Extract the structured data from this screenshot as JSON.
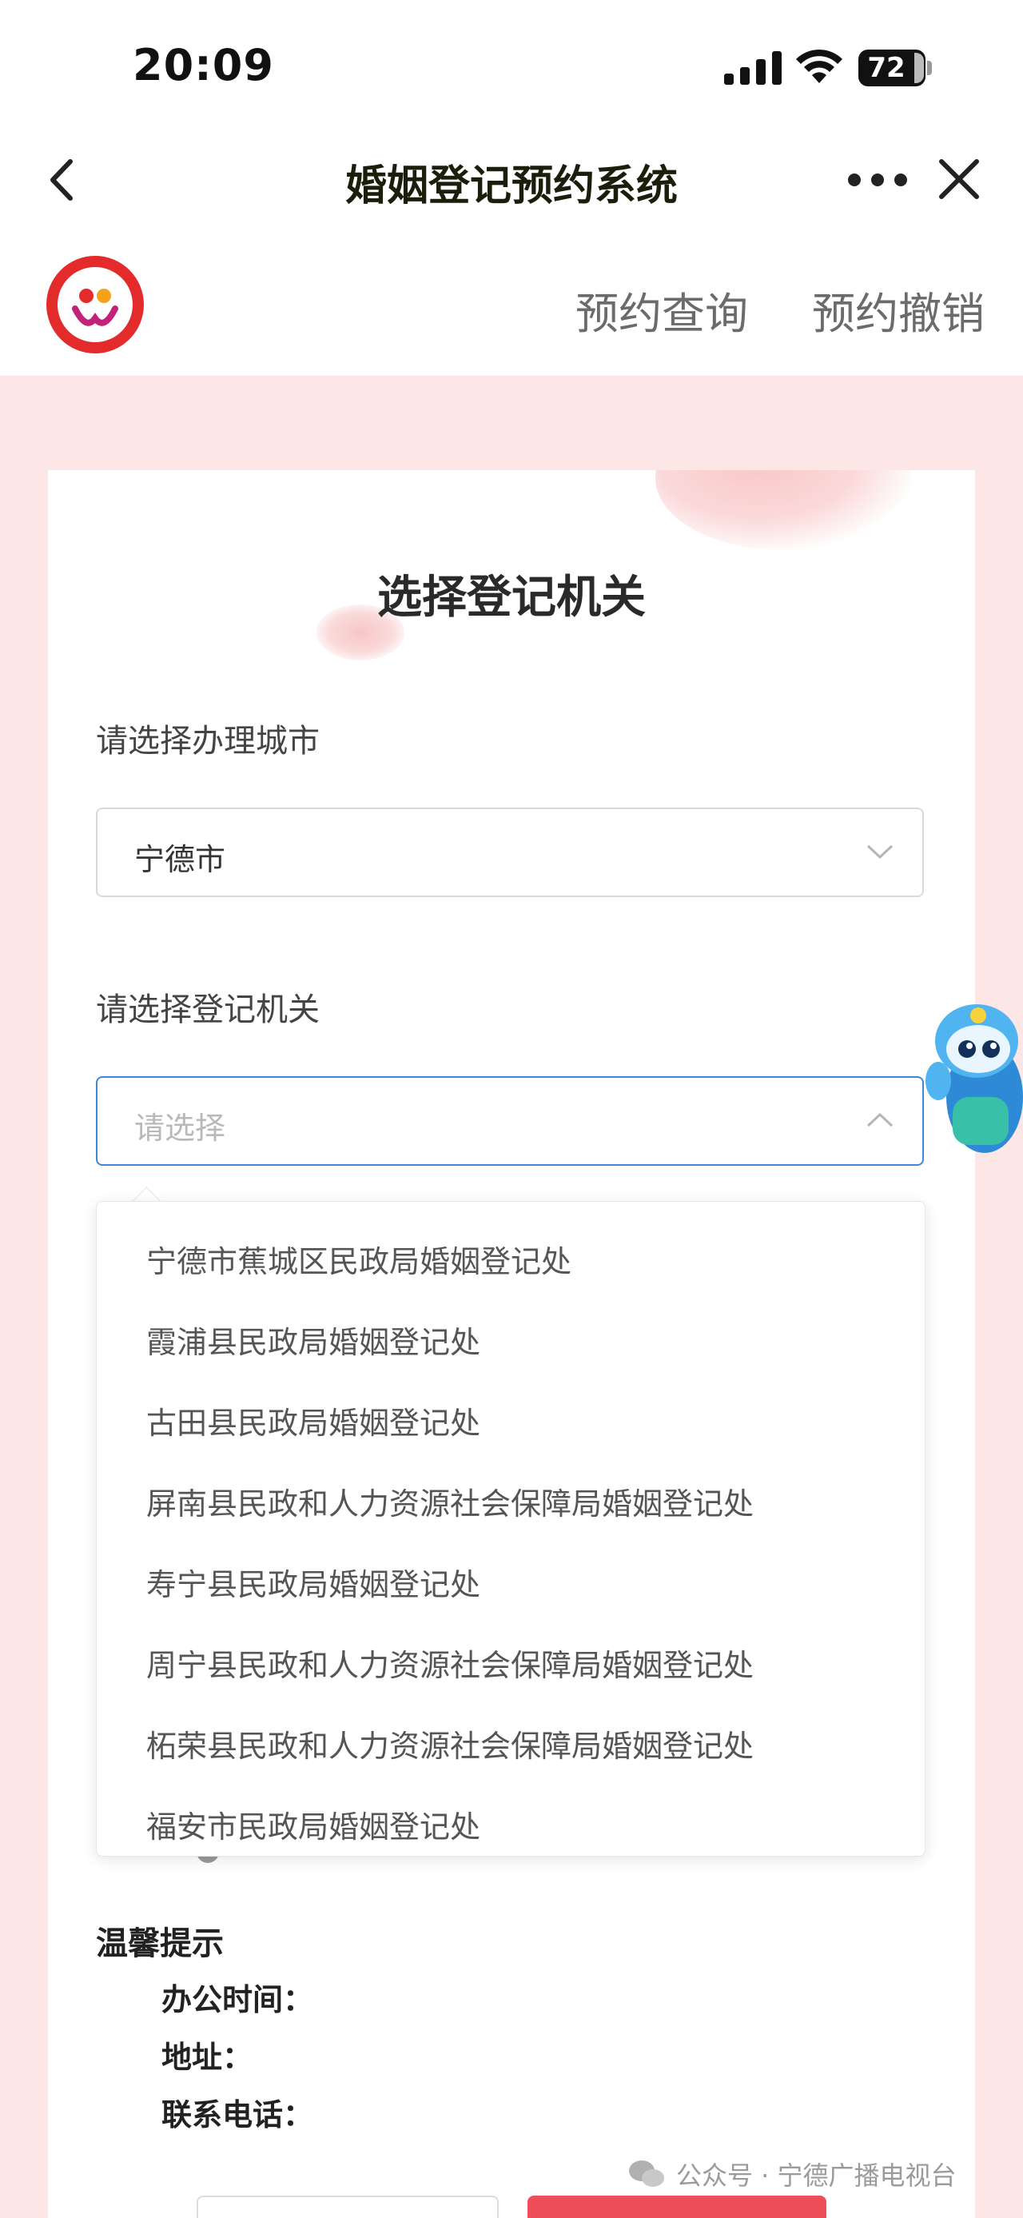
{
  "status_bar": {
    "time": "20:09",
    "battery": "72"
  },
  "nav": {
    "title": "婚姻登记预约系统"
  },
  "header": {
    "links": [
      "预约查询",
      "预约撤销"
    ]
  },
  "form": {
    "title": "选择登记机关",
    "city_label": "请选择办理城市",
    "city_value": "宁德市",
    "office_label": "请选择登记机关",
    "office_placeholder": "请选择"
  },
  "dropdown": {
    "options": [
      "宁德市蕉城区民政局婚姻登记处",
      "霞浦县民政局婚姻登记处",
      "古田县民政局婚姻登记处",
      "屏南县民政和人力资源社会保障局婚姻登记处",
      "寿宁县民政局婚姻登记处",
      "周宁县民政和人力资源社会保障局婚姻登记处",
      "柘荣县民政和人力资源社会保障局婚姻登记处",
      "福安市民政局婚姻登记处"
    ]
  },
  "tips": {
    "title": "温馨提示",
    "office_hours": "办公时间：",
    "address": "地址：",
    "phone": "联系电话："
  },
  "watermark": {
    "text": "公众号 · 宁德广播电视台"
  },
  "colors": {
    "accent_blue": "#3b87d8",
    "primary_red": "#ee4d5a",
    "pink_bg": "#fde6e6"
  }
}
